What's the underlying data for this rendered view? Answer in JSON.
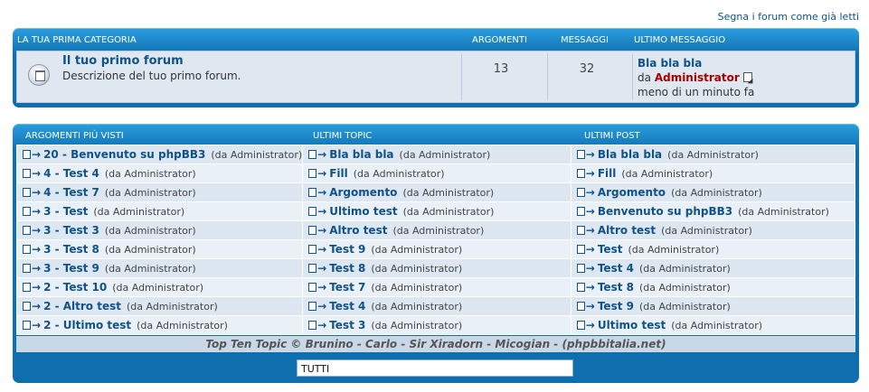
{
  "top_link": "Segna i forum come già letti",
  "category": {
    "title": "LA TUA PRIMA CATEGORIA",
    "col_topics": "ARGOMENTI",
    "col_posts": "MESSAGGI",
    "col_last": "ULTIMO MESSAGGIO"
  },
  "forum": {
    "icon": "forum-read-icon",
    "title": "Il tuo primo forum",
    "description": "Descrizione del tuo primo forum.",
    "topics": "13",
    "posts": "32",
    "last_title": "Bla bla bla",
    "last_by_prefix": "da",
    "last_author": "Administrator",
    "last_time": "meno di un minuto fa"
  },
  "topten": {
    "headers": [
      "ARGOMENTI PIÙ VISTI",
      "ULTIMI TOPIC",
      "ULTIMI POST"
    ],
    "rows": [
      [
        {
          "t": "20 - Benvenuto su phpBB3",
          "by": "(da Administrator)"
        },
        {
          "t": "Bla bla bla",
          "by": "(da Administrator)"
        },
        {
          "t": "Bla bla bla",
          "by": "(da Administrator)"
        }
      ],
      [
        {
          "t": "4 - Test 4",
          "by": "(da Administrator)"
        },
        {
          "t": "Fill",
          "by": "(da Administrator)"
        },
        {
          "t": "Fill",
          "by": "(da Administrator)"
        }
      ],
      [
        {
          "t": "4 - Test 7",
          "by": "(da Administrator)"
        },
        {
          "t": "Argomento",
          "by": "(da Administrator)"
        },
        {
          "t": "Argomento",
          "by": "(da Administrator)"
        }
      ],
      [
        {
          "t": "3 - Test",
          "by": "(da Administrator)"
        },
        {
          "t": "Ultimo test",
          "by": "(da Administrator)"
        },
        {
          "t": "Benvenuto su phpBB3",
          "by": "(da Administrator)"
        }
      ],
      [
        {
          "t": "3 - Test 3",
          "by": "(da Administrator)"
        },
        {
          "t": "Altro test",
          "by": "(da Administrator)"
        },
        {
          "t": "Altro test",
          "by": "(da Administrator)"
        }
      ],
      [
        {
          "t": "3 - Test 8",
          "by": "(da Administrator)"
        },
        {
          "t": "Test 9",
          "by": "(da Administrator)"
        },
        {
          "t": "Test",
          "by": "(da Administrator)"
        }
      ],
      [
        {
          "t": "3 - Test 9",
          "by": "(da Administrator)"
        },
        {
          "t": "Test 8",
          "by": "(da Administrator)"
        },
        {
          "t": "Test 4",
          "by": "(da Administrator)"
        }
      ],
      [
        {
          "t": "2 - Test 10",
          "by": "(da Administrator)"
        },
        {
          "t": "Test 7",
          "by": "(da Administrator)"
        },
        {
          "t": "Test 8",
          "by": "(da Administrator)"
        }
      ],
      [
        {
          "t": "2 - Altro test",
          "by": "(da Administrator)"
        },
        {
          "t": "Test 4",
          "by": "(da Administrator)"
        },
        {
          "t": "Test 9",
          "by": "(da Administrator)"
        }
      ],
      [
        {
          "t": "2 - Ultimo test",
          "by": "(da Administrator)"
        },
        {
          "t": "Test 3",
          "by": "(da Administrator)"
        },
        {
          "t": "Ultimo test",
          "by": "(da Administrator)"
        }
      ]
    ],
    "footer": "Top Ten Topic © Brunino - Carlo - Sir Xiradorn - Micogian - (phpbbitalia.net)",
    "filter_value": "TUTTI"
  }
}
